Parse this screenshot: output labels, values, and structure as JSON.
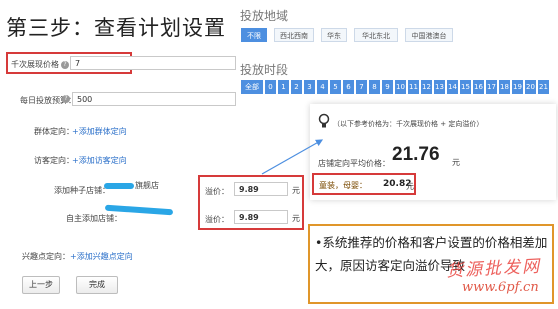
{
  "slide_title": "第三步：查看计划设置",
  "form": {
    "cpm_label": "千次展现价格",
    "cpm_value": "7",
    "daily_budget_label": "每日投放预算：",
    "daily_budget_value": "500",
    "group_target_label": "群体定向：",
    "group_target_link": "添加群体定向",
    "visitor_target_label": "访客定向：",
    "visitor_target_link": "添加访客定向",
    "seed_shop_label": "添加种子店铺：",
    "seed_shop_name": "旗舰店",
    "self_shop_label": "自主添加店铺：",
    "premium_label": "溢价：",
    "premium_value_1": "9.89",
    "premium_value_2": "9.89",
    "currency_unit": "元",
    "interest_target_label": "兴趣点定向：",
    "interest_target_link": "添加兴趣点定向",
    "prev_button": "上一步",
    "finish_button": "完成"
  },
  "region": {
    "title": "投放地域",
    "options": [
      "不限",
      "西北西南",
      "华东",
      "华北东北",
      "中国港澳台"
    ],
    "selected": "不限"
  },
  "time_slot": {
    "title": "投放时段",
    "all_label": "全部",
    "hours": [
      "0",
      "1",
      "2",
      "3",
      "4",
      "5",
      "6",
      "7",
      "8",
      "9",
      "10",
      "11",
      "12",
      "13",
      "14",
      "15",
      "16",
      "17",
      "18",
      "19",
      "20",
      "21"
    ]
  },
  "reference": {
    "note": "（以下参考价格为：千次展现价格 + 定向溢价）",
    "avg_label": "店铺定向平均价格：",
    "avg_value": "21.76",
    "unit": "元",
    "shop_label": "童装，母婴：",
    "shop_value": "20.82",
    "shop_unit": "元"
  },
  "explanation": {
    "bullet": "•",
    "text": "系统推荐的价格和客户设置的价格相差加大，原因访客定向溢价导致"
  },
  "watermark": {
    "brand": "货源批发网",
    "url": "www.6pf.cn"
  },
  "colors": {
    "highlight_red": "#d63a3a",
    "accent_blue": "#4d8fe0",
    "callout_border": "#e0962a",
    "watermark_red": "#e8342f"
  }
}
